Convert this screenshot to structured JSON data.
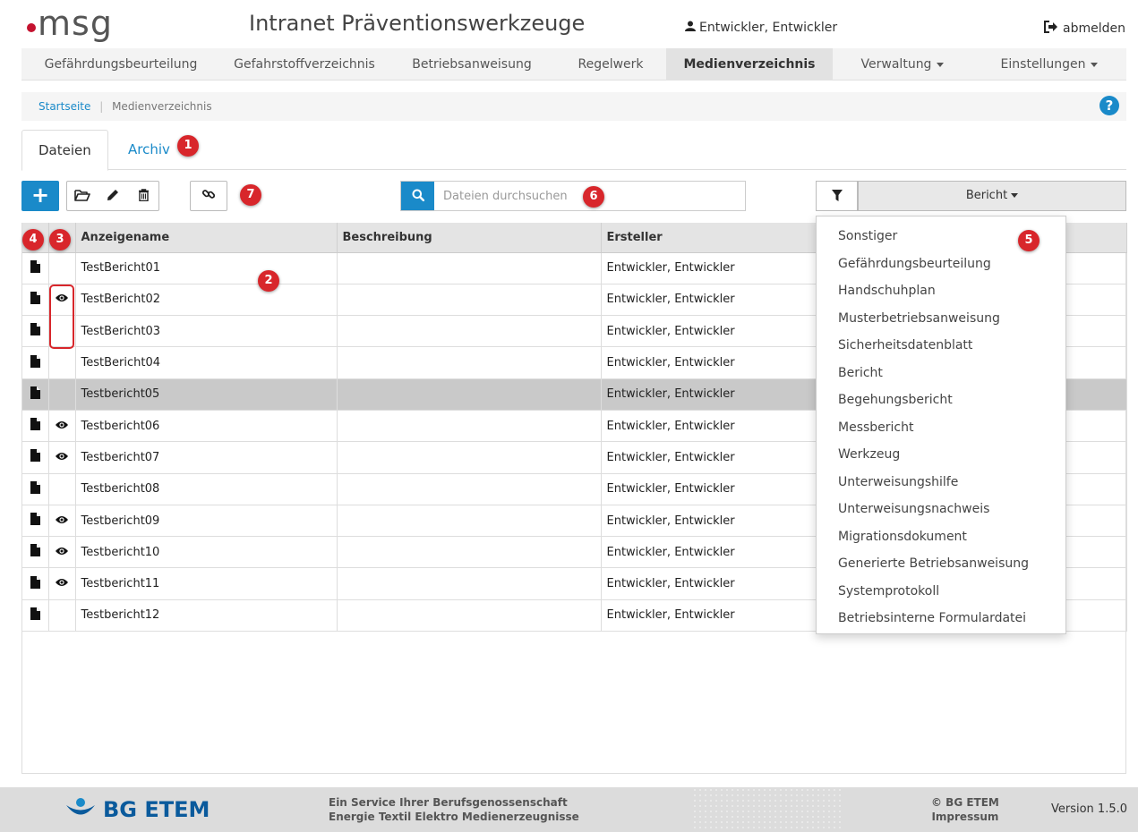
{
  "header": {
    "logo_text": "msg",
    "title": "Intranet Präventionswerkzeuge",
    "user": "Entwickler, Entwickler",
    "logout": "abmelden"
  },
  "nav": {
    "items": [
      {
        "label": "Gefährdungsbeurteilung"
      },
      {
        "label": "Gefahrstoffverzeichnis"
      },
      {
        "label": "Betriebsanweisung"
      },
      {
        "label": "Regelwerk"
      },
      {
        "label": "Medienverzeichnis",
        "active": true
      },
      {
        "label": "Verwaltung",
        "dropdown": true
      },
      {
        "label": "Einstellungen",
        "dropdown": true
      }
    ]
  },
  "breadcrumb": {
    "home": "Startseite",
    "current": "Medienverzeichnis",
    "help": "?"
  },
  "tabs": {
    "files": "Dateien",
    "archive": "Archiv"
  },
  "toolbar": {
    "add": "+",
    "search_placeholder": "Dateien durchsuchen",
    "filter_value": "Bericht"
  },
  "table": {
    "columns": [
      "Anzeigename",
      "Beschreibung",
      "Ersteller"
    ],
    "rows": [
      {
        "name": "TestBericht01",
        "description": "",
        "creator": "Entwickler, Entwickler",
        "eye": false
      },
      {
        "name": "TestBericht02",
        "description": "",
        "creator": "Entwickler, Entwickler",
        "eye": true
      },
      {
        "name": "TestBericht03",
        "description": "",
        "creator": "Entwickler, Entwickler",
        "eye": false
      },
      {
        "name": "TestBericht04",
        "description": "",
        "creator": "Entwickler, Entwickler",
        "eye": false
      },
      {
        "name": "Testbericht05",
        "description": "",
        "creator": "Entwickler, Entwickler",
        "eye": false,
        "selected": true
      },
      {
        "name": "Testbericht06",
        "description": "",
        "creator": "Entwickler, Entwickler",
        "eye": true
      },
      {
        "name": "Testbericht07",
        "description": "",
        "creator": "Entwickler, Entwickler",
        "eye": true
      },
      {
        "name": "Testbericht08",
        "description": "",
        "creator": "Entwickler, Entwickler",
        "eye": false
      },
      {
        "name": "Testbericht09",
        "description": "",
        "creator": "Entwickler, Entwickler",
        "eye": true
      },
      {
        "name": "Testbericht10",
        "description": "",
        "creator": "Entwickler, Entwickler",
        "eye": true
      },
      {
        "name": "Testbericht11",
        "description": "",
        "creator": "Entwickler, Entwickler",
        "eye": true
      },
      {
        "name": "Testbericht12",
        "description": "",
        "creator": "Entwickler, Entwickler",
        "eye": false
      }
    ]
  },
  "dropdown": {
    "options": [
      "Sonstiger",
      "Gefährdungsbeurteilung",
      "Handschuhplan",
      "Musterbetriebsanweisung",
      "Sicherheitsdatenblatt",
      "Bericht",
      "Begehungsbericht",
      "Messbericht",
      "Werkzeug",
      "Unterweisungshilfe",
      "Unterweisungsnachweis",
      "Migrationsdokument",
      "Generierte Betriebsanweisung",
      "Systemprotokoll",
      "Betriebsinterne Formulardatei"
    ]
  },
  "annotations": [
    "1",
    "2",
    "3",
    "4",
    "5",
    "6",
    "7"
  ],
  "footer": {
    "org": "BG ETEM",
    "service_line1": "Ein Service Ihrer Berufsgenossenschaft",
    "service_line2": "Energie Textil Elektro Medienerzeugnisse",
    "copyright": "© BG ETEM",
    "imprint": "Impressum",
    "version": "Version 1.5.0"
  },
  "colors": {
    "accent": "#1a8ac9",
    "annotation": "#d8262b",
    "selected_row": "#c9c9c9"
  }
}
